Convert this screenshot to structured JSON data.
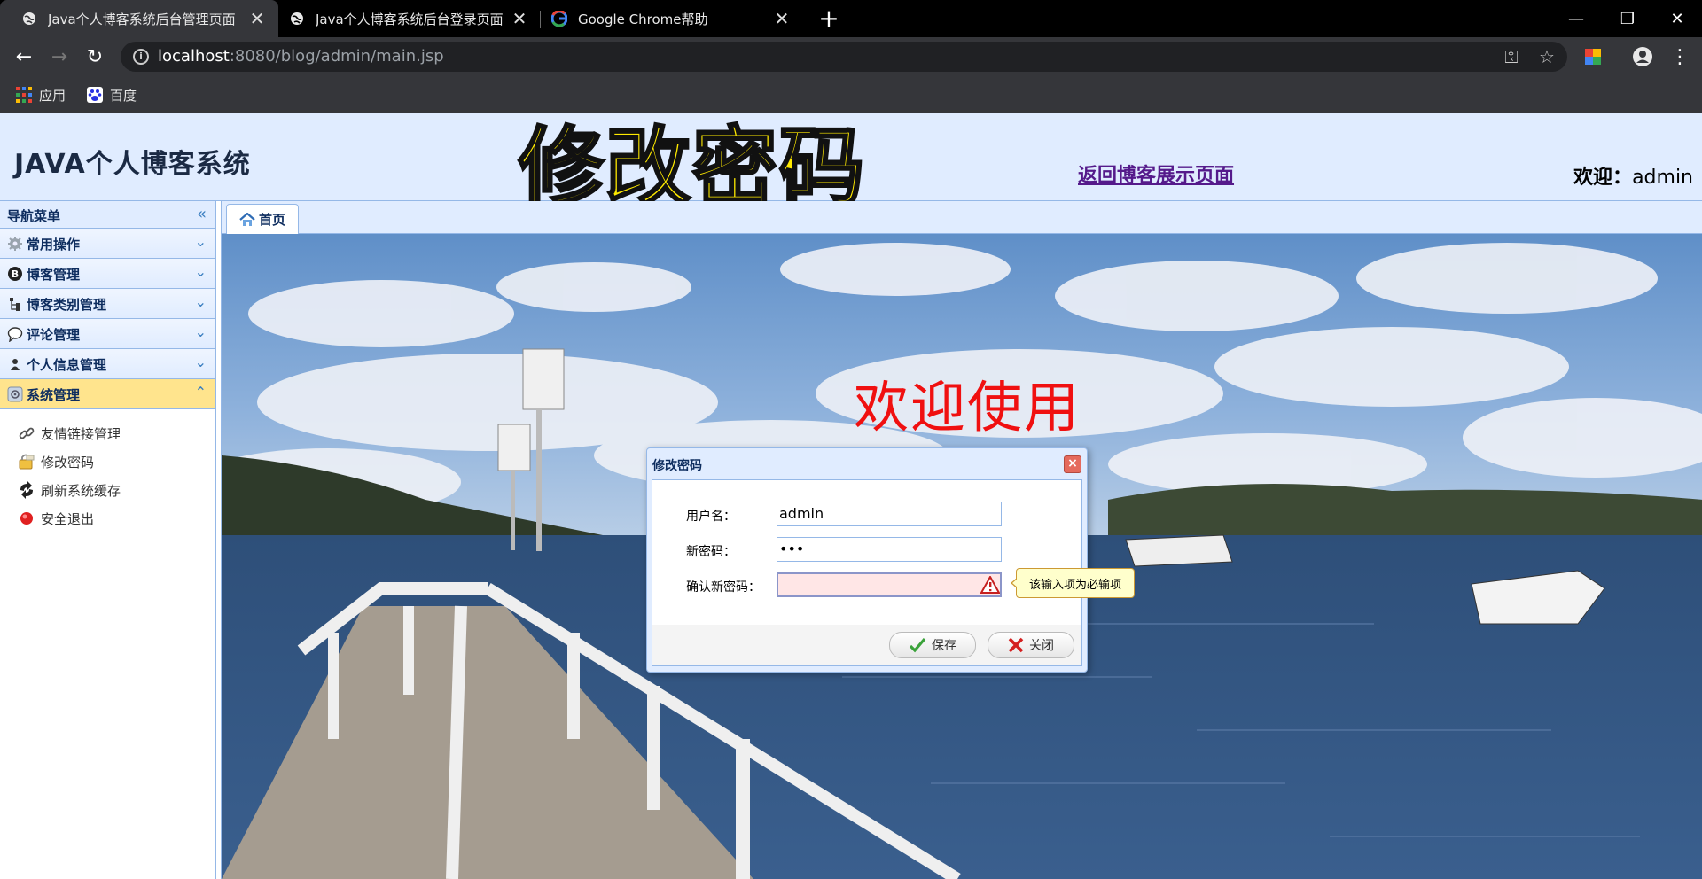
{
  "browser": {
    "tabs": [
      {
        "title": "Java个人博客系统后台管理页面",
        "active": true
      },
      {
        "title": "Java个人博客系统后台登录页面",
        "active": false
      },
      {
        "title": "Google Chrome帮助",
        "active": false
      }
    ],
    "new_tab_symbol": "+",
    "url_host": "localhost",
    "url_rest": ":8080/blog/admin/main.jsp",
    "bookmarks": [
      {
        "label": "应用",
        "icon": "apps-grid-icon"
      },
      {
        "label": "百度",
        "icon": "baidu-paw-icon"
      }
    ]
  },
  "header": {
    "logo": "JAVA个人博客系统",
    "overlay_title": "修改密码",
    "back_link": "返回博客展示页面",
    "welcome_label": "欢迎：",
    "welcome_user": "admin"
  },
  "sidebar": {
    "title": "导航菜单",
    "sections": [
      {
        "label": "常用操作",
        "icon": "gears-icon"
      },
      {
        "label": "博客管理",
        "icon": "blog-icon"
      },
      {
        "label": "博客类别管理",
        "icon": "tree-icon"
      },
      {
        "label": "评论管理",
        "icon": "comment-icon"
      },
      {
        "label": "个人信息管理",
        "icon": "user-icon"
      },
      {
        "label": "系统管理",
        "icon": "system-icon",
        "selected": true
      }
    ],
    "system_items": [
      {
        "label": "友情链接管理",
        "icon": "link-icon"
      },
      {
        "label": "修改密码",
        "icon": "lock-icon"
      },
      {
        "label": "刷新系统缓存",
        "icon": "refresh-icon"
      },
      {
        "label": "安全退出",
        "icon": "exit-icon"
      }
    ]
  },
  "main": {
    "tab_home": "首页",
    "welcome_text": "欢迎使用"
  },
  "dialog": {
    "title": "修改密码",
    "fields": {
      "username_label": "用户名：",
      "username_value": "admin",
      "new_password_label": "新密码：",
      "new_password_value": "•••",
      "confirm_label": "确认新密码：",
      "confirm_value": ""
    },
    "validation_tip": "该输入项为必输项",
    "save_label": "保存",
    "close_label": "关闭"
  },
  "colors": {
    "panel_bg": "#e0ecff",
    "panel_border": "#95b8e7",
    "selected_section": "#ffe48d",
    "overlay_title": "#ffea00",
    "welcome_text": "#f01010"
  }
}
